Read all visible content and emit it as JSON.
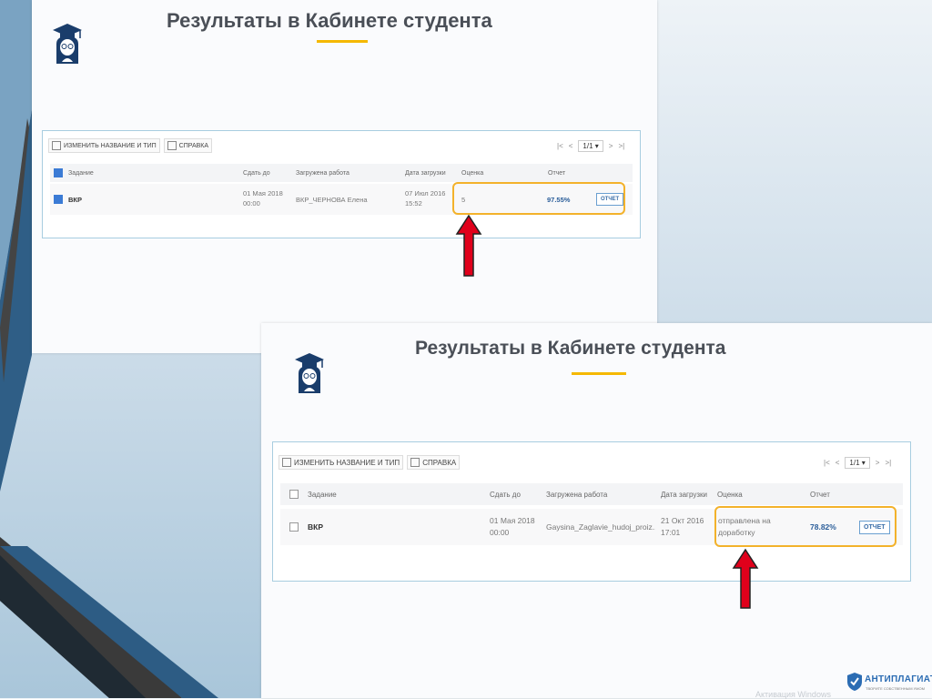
{
  "colors": {
    "accent": "#f5b800",
    "highlight": "#f3b22b",
    "arrow": "#e0001b",
    "link": "#2b6cb3"
  },
  "screen1": {
    "title": "Результаты в Кабинете студента",
    "toolbar": {
      "rename": "ИЗМЕНИТЬ НАЗВАНИЕ И ТИП",
      "help": "СПРАВКА"
    },
    "pager": {
      "first": "|<",
      "prev": "<",
      "page": "1/1",
      "next": ">",
      "last": ">|"
    },
    "headers": {
      "task": "Задание",
      "due": "Сдать до",
      "uploaded": "Загружена работа",
      "date": "Дата загрузки",
      "grade": "Оценка",
      "report": "Отчет"
    },
    "row": {
      "task": "ВКР",
      "due1": "01 Мая 2018",
      "due2": "00:00",
      "uploaded": "ВКР_ЧЕРНОВА Елена",
      "date1": "07 Июл 2016",
      "date2": "15:52",
      "grade": "5",
      "percent": "97.55%",
      "report_btn": "ОТЧЕТ"
    }
  },
  "screen2": {
    "title": "Результаты в Кабинете студента",
    "toolbar": {
      "rename": "ИЗМЕНИТЬ НАЗВАНИЕ И ТИП",
      "help": "СПРАВКА"
    },
    "pager": {
      "first": "|<",
      "prev": "<",
      "page": "1/1",
      "next": ">",
      "last": ">|"
    },
    "headers": {
      "task": "Задание",
      "due": "Сдать до",
      "uploaded": "Загружена работа",
      "date": "Дата загрузки",
      "grade": "Оценка",
      "report": "Отчет"
    },
    "row": {
      "task": "ВКР",
      "due1": "01 Мая 2018",
      "due2": "00:00",
      "uploaded": "Gaysina_Zaglavie_hudoj_proiz...",
      "date1": "21 Окт 2016",
      "date2": "17:01",
      "grade1": "отправлена на",
      "grade2": "доработку",
      "percent": "78.82%",
      "report_btn": "ОТЧЕТ"
    }
  },
  "logo": {
    "name": "АНТИПЛАГИАТ",
    "tagline": "ТВОРИТЕ СОБСТВЕННЫМ УМОМ"
  },
  "watermark": "Активация Windows",
  "icons": {
    "avatar": "student-graduate-icon",
    "arrow": "red-up-arrow-icon",
    "logo": "shield-icon"
  }
}
